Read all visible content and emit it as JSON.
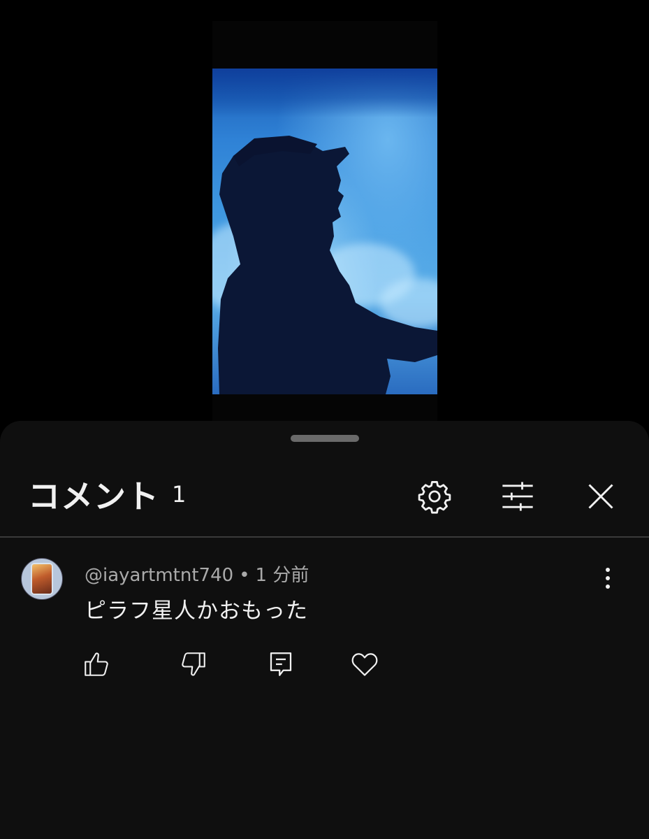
{
  "video": {
    "accent_color": "#3f98e0"
  },
  "comments_panel": {
    "title": "コメント",
    "count": "1",
    "icons": {
      "settings": "gear-icon",
      "filter": "sliders-icon",
      "close": "close-icon"
    }
  },
  "comments": [
    {
      "author": "@iayartmtnt740",
      "separator": "•",
      "time": "1 分前",
      "text": "ピラフ星人かおもった",
      "actions": [
        "thumbs-up-icon",
        "thumbs-down-icon",
        "reply-icon",
        "heart-icon"
      ]
    }
  ],
  "colors": {
    "sheet_bg": "#0f0f0f",
    "text_primary": "#f1f1f1",
    "text_secondary": "#aaaaaa",
    "divider": "#3a3a3a"
  }
}
